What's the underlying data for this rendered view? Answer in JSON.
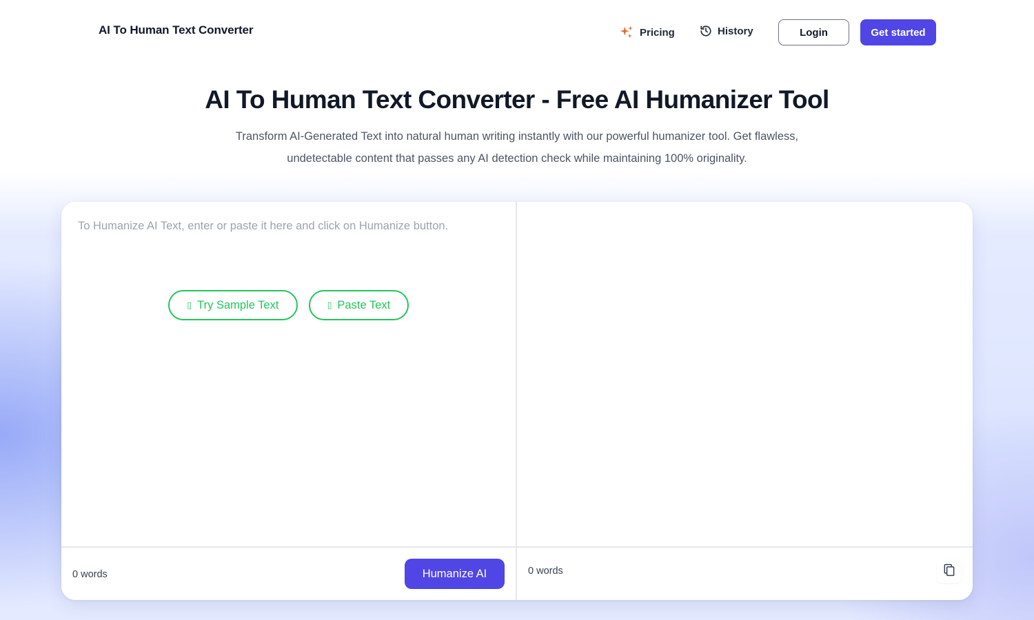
{
  "header": {
    "brand": "AI To Human Text Converter",
    "nav": {
      "pricing_label": "Pricing",
      "history_label": "History"
    },
    "login_label": "Login",
    "get_started_label": "Get started",
    "icons": {
      "pricing": "sparkles-icon",
      "history": "history-icon"
    },
    "colors": {
      "sparkles": "#e26d2e",
      "primary": "#4f46e5"
    }
  },
  "hero": {
    "title": "AI To Human Text Converter - Free AI Humanizer Tool",
    "subtitle": "Transform AI-Generated Text into natural human writing instantly with our powerful humanizer tool. Get flawless, undetectable content that passes any AI detection check while maintaining 100% originality."
  },
  "editor": {
    "input": {
      "placeholder": "To Humanize AI Text, enter or paste it here and click on Humanize button.",
      "value": "",
      "try_sample_label": "Try Sample Text",
      "paste_label": "Paste Text",
      "word_count": "0 words",
      "humanize_label": "Humanize AI"
    },
    "output": {
      "value": "",
      "word_count": "0 words",
      "copy_icon": "copy-icon"
    },
    "accent_green": "#22c55e"
  }
}
